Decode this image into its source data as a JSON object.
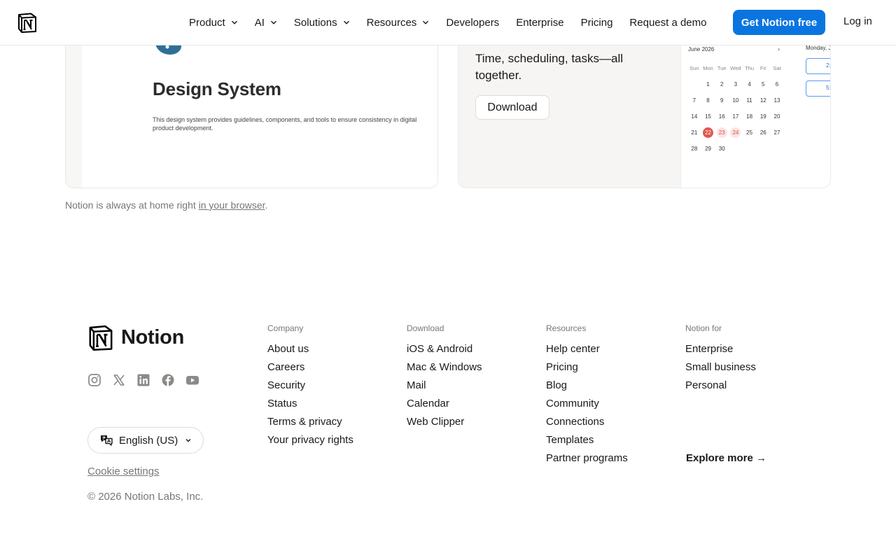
{
  "header": {
    "nav": [
      {
        "label": "Product",
        "has_menu": true
      },
      {
        "label": "AI",
        "has_menu": true
      },
      {
        "label": "Solutions",
        "has_menu": true
      },
      {
        "label": "Resources",
        "has_menu": true
      },
      {
        "label": "Developers",
        "has_menu": false
      },
      {
        "label": "Enterprise",
        "has_menu": false
      },
      {
        "label": "Pricing",
        "has_menu": false
      },
      {
        "label": "Request a demo",
        "has_menu": false
      }
    ],
    "cta_label": "Get Notion free",
    "login_label": "Log in",
    "cta_color": "#0a75e0"
  },
  "cards": {
    "design_system": {
      "title": "Design System",
      "description": "This design system provides guidelines, components, and tools to ensure consistency in digital product development."
    },
    "calendar": {
      "tagline": "Time, scheduling, tasks—all together.",
      "download_label": "Download",
      "month_label": "June 2026",
      "next_icon": "›",
      "weekdays": [
        "Sun",
        "Mon",
        "Tue",
        "Wed",
        "Thu",
        "Fri",
        "Sat"
      ],
      "weeks": [
        [
          "",
          "1",
          "2",
          "3",
          "4",
          "5",
          "6"
        ],
        [
          "7",
          "8",
          "9",
          "10",
          "11",
          "12",
          "13"
        ],
        [
          "14",
          "15",
          "16",
          "17",
          "18",
          "19",
          "20"
        ],
        [
          "21",
          "22",
          "23",
          "24",
          "25",
          "26",
          "27"
        ],
        [
          "28",
          "29",
          "30",
          "",
          "",
          "",
          ""
        ]
      ],
      "today": "22",
      "highlighted": [
        "23",
        "24"
      ],
      "day_view_label": "Monday, J",
      "events": [
        "2:",
        "5:"
      ]
    }
  },
  "browser_note": {
    "prefix": "Notion is always at home right ",
    "link": "in your browser",
    "suffix": "."
  },
  "footer": {
    "brand": "Notion",
    "socials": [
      "instagram-icon",
      "x-icon",
      "linkedin-icon",
      "facebook-icon",
      "youtube-icon"
    ],
    "language": "English (US)",
    "cookie_settings": "Cookie settings",
    "copyright": "© 2026 Notion Labs, Inc.",
    "columns": [
      {
        "heading": "Company",
        "links": [
          "About us",
          "Careers",
          "Security",
          "Status",
          "Terms & privacy",
          "Your privacy rights"
        ]
      },
      {
        "heading": "Download",
        "links": [
          "iOS & Android",
          "Mac & Windows",
          "Mail",
          "Calendar",
          "Web Clipper"
        ]
      },
      {
        "heading": "Resources",
        "links": [
          "Help center",
          "Pricing",
          "Blog",
          "Community",
          "Connections",
          "Templates",
          "Partner programs"
        ]
      },
      {
        "heading": "Notion for",
        "links": [
          "Enterprise",
          "Small business",
          "Personal"
        ]
      }
    ],
    "explore_more": "Explore more →"
  }
}
